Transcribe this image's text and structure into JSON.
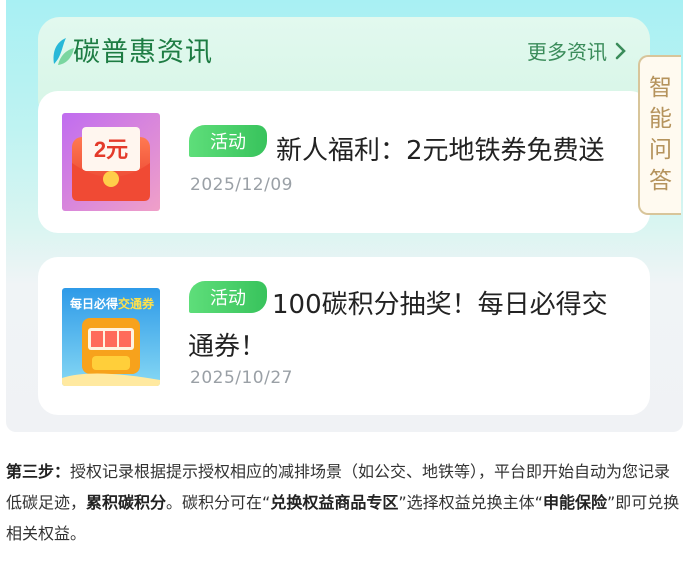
{
  "news": {
    "title": "碳普惠资讯",
    "more": "更多资讯"
  },
  "items": [
    {
      "badge": "活动",
      "title": "新人福利：2元地铁券免费送",
      "date": "2025/12/09",
      "thumb_text": "2元"
    },
    {
      "badge": "活动",
      "title": "100碳积分抽奖！每日必得交通券！",
      "date": "2025/10/27",
      "thumb_text_a": "每日必得",
      "thumb_text_b": "交通券"
    }
  ],
  "side_tab": [
    "智",
    "能",
    "问",
    "答"
  ],
  "step": {
    "label": "第三步：",
    "text1": "授权记录根据提示授权相应的减排场景（如公交、地铁等），平台即开始自动为您记录低碳足迹，",
    "bold1": "累积碳积分",
    "text2": "。碳积分可在“",
    "bold2": "兑换权益商品专区",
    "text3": "”选择权益兑换主体“",
    "bold3": "申能保险",
    "text4": "”即可兑换相关权益。"
  },
  "colors": {
    "accent": "#1d7c43",
    "badge": "#38c35c",
    "tab_border": "#d8c59a"
  }
}
